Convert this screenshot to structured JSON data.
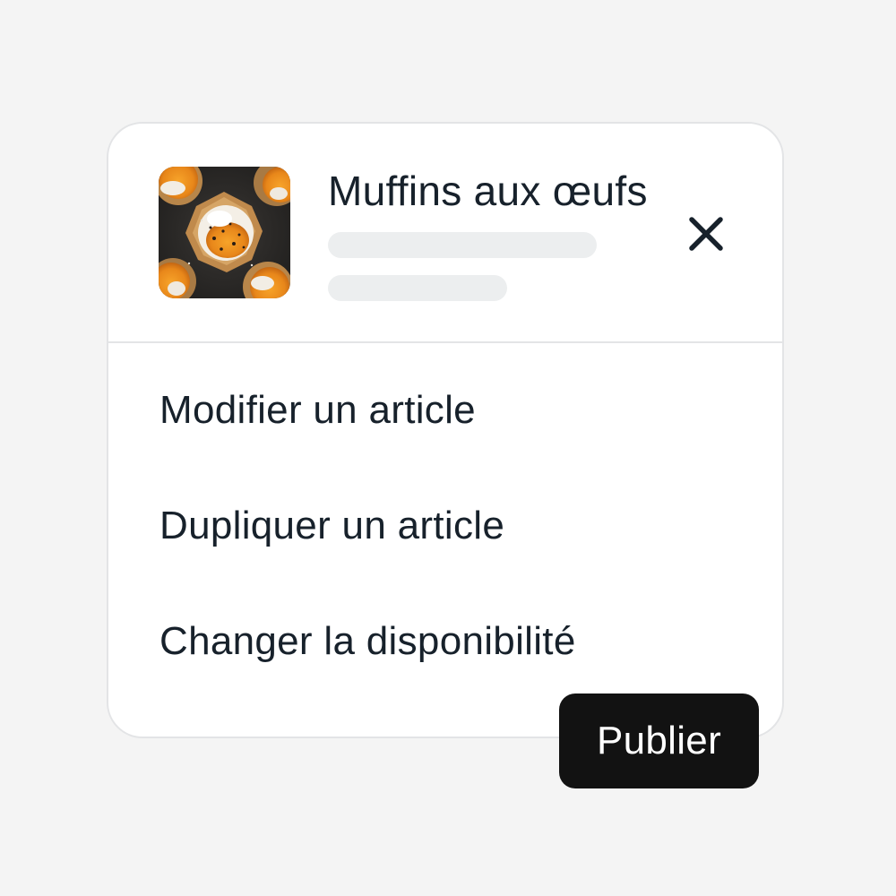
{
  "product": {
    "title": "Muffins aux œufs",
    "image_icon": "egg-muffin-photo"
  },
  "header": {
    "close_icon": "close-icon"
  },
  "menu": {
    "items": [
      {
        "label": "Modifier un article"
      },
      {
        "label": "Dupliquer un article"
      },
      {
        "label": "Changer la disponibilité"
      }
    ]
  },
  "actions": {
    "publish_label": "Publier"
  },
  "colors": {
    "background": "#f4f4f4",
    "card": "#ffffff",
    "border": "#e3e4e6",
    "text": "#17212b",
    "skeleton": "#eceeef",
    "button_bg": "#121212",
    "button_text": "#ffffff"
  }
}
